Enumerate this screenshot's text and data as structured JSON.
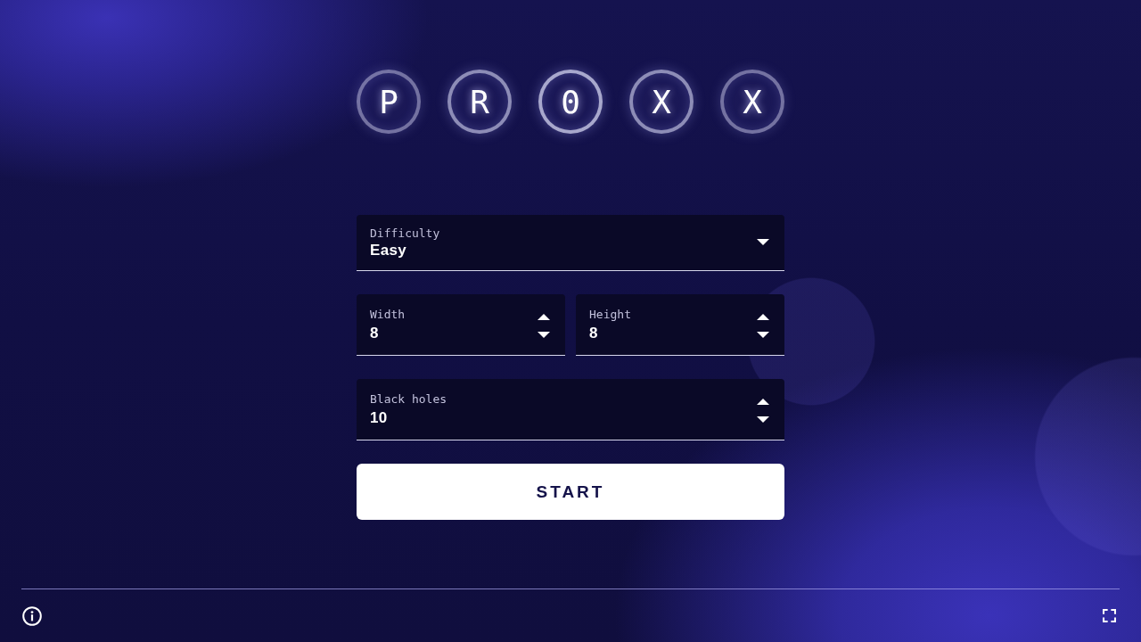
{
  "logo": {
    "letters": [
      "P",
      "R",
      "0",
      "X",
      "X"
    ]
  },
  "form": {
    "rows": [
      {
        "fields": [
          {
            "kind": "select",
            "label": "Difficulty",
            "value": "Easy"
          }
        ]
      },
      {
        "fields": [
          {
            "kind": "number",
            "label": "Width",
            "value": "8"
          },
          {
            "kind": "number",
            "label": "Height",
            "value": "8"
          }
        ]
      },
      {
        "fields": [
          {
            "kind": "number",
            "label": "Black holes",
            "value": "10"
          }
        ]
      }
    ],
    "start_button": {
      "label": "START"
    }
  }
}
